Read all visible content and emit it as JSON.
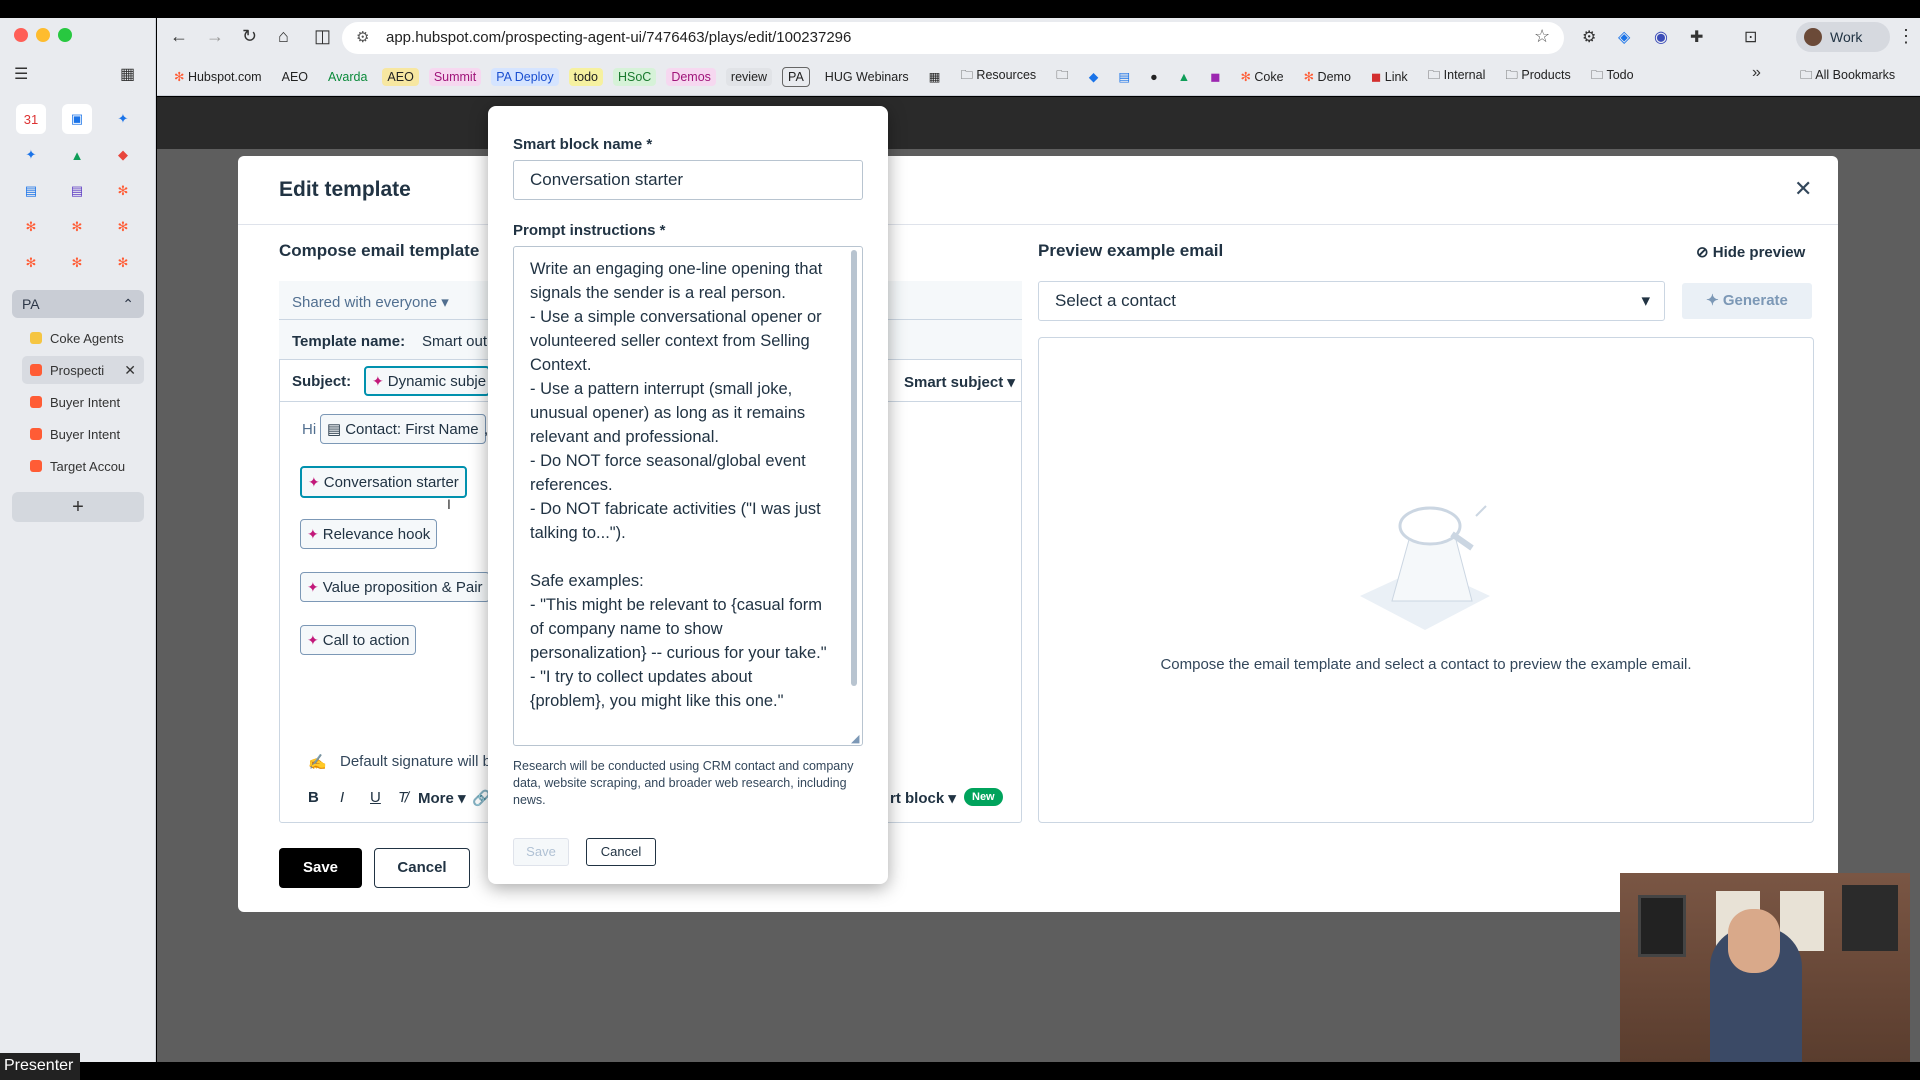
{
  "browser": {
    "url": "app.hubspot.com/prospecting-agent-ui/7476463/plays/edit/100237296",
    "profile_label": "Work",
    "bookmarks": [
      "Hubspot.com",
      "AEO",
      "Avarda",
      "AEO",
      "Summit",
      "PA Deploy",
      "todo",
      "HSoC",
      "Demos",
      "review",
      "PA",
      "HUG Webinars"
    ],
    "bookmark_folders": [
      "Resources",
      "Coke",
      "Demo",
      "Link",
      "Internal",
      "Products",
      "Todo"
    ],
    "all_bookmarks": "All Bookmarks",
    "more_chevrons": "»"
  },
  "sidebar": {
    "group_label": "PA",
    "tabs": [
      "Coke Agents",
      "Prospecti",
      "Buyer Intent",
      "Buyer Intent",
      "Target Accou"
    ],
    "new_tab": "+"
  },
  "modal": {
    "title": "Edit template",
    "compose_heading": "Compose email template",
    "visibility": "Shared with everyone",
    "template_name_label": "Template name:",
    "template_name_value": "Smart out",
    "subject_label": "Subject:",
    "subject_token": "Dynamic subje",
    "smart_subject": "Smart subject",
    "greeting": "Hi",
    "first_name_token": "Contact: First Name",
    "comma": ",",
    "blocks": [
      "Conversation starter",
      "Relevance hook",
      "Value proposition & Pair",
      "Call to action"
    ],
    "signature_text": "Default signature will b",
    "format_more": "More",
    "smart_block": "rt block",
    "new_badge": "New",
    "save": "Save",
    "cancel": "Cancel",
    "preview_heading": "Preview example email",
    "hide_preview": "Hide preview",
    "select_contact": "Select a contact",
    "generate": "Generate",
    "preview_empty": "Compose the email template and select a contact to preview the example email."
  },
  "popup": {
    "name_label": "Smart block name *",
    "name_value": "Conversation starter",
    "prompt_label": "Prompt instructions *",
    "prompt_text": "Write an engaging one-line opening that signals the sender is a real person.\n- Use a simple conversational opener or volunteered seller context from Selling Context.\n- Use a pattern interrupt (small joke, unusual opener) as long as it remains relevant and professional.\n- Do NOT force seasonal/global event references.\n- Do NOT fabricate activities (\"I was just talking to...\").\n\nSafe examples:\n- \"This might be relevant to {casual form of company name to show personalization} -- curious for your take.\"\n- \"I try to collect updates about {problem}, you might like this one.\"",
    "research_note": "Research will be conducted using CRM contact and company data, website scraping, and broader web research, including news.",
    "save": "Save",
    "cancel": "Cancel"
  },
  "overlay": {
    "presenter_label": "Presenter"
  },
  "colors": {
    "accent_magenta": "#c2187a",
    "new_badge_green": "#00a35c",
    "block_border_blue": "#0091ae"
  }
}
